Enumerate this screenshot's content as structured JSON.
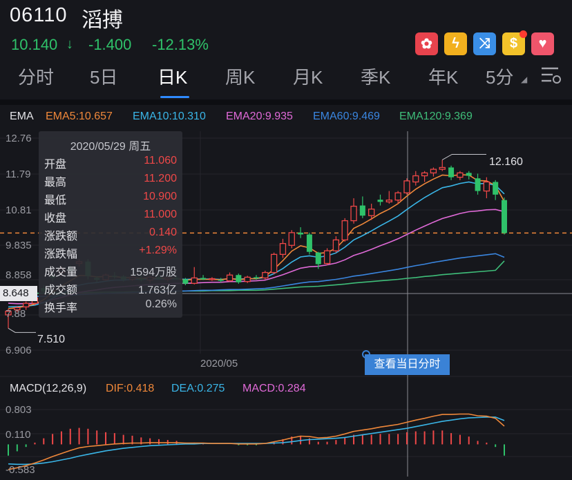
{
  "header": {
    "code": "06110",
    "name": "滔搏",
    "price": "10.140",
    "price_arrow": "↓",
    "change": "-1.400",
    "change_pct": "-12.13%"
  },
  "badges": [
    {
      "icon": "hk-flag-icon",
      "glyph": "✿",
      "color": "#e8434d"
    },
    {
      "icon": "lightning-icon",
      "glyph": "ϟ",
      "color": "#f2b01e"
    },
    {
      "icon": "shuffle-icon",
      "glyph": "⤨",
      "color": "#3a8ee6"
    },
    {
      "icon": "dollar-icon",
      "glyph": "$",
      "color": "#f2c22a"
    },
    {
      "icon": "heart-icon",
      "glyph": "♥",
      "color": "#f0556b"
    }
  ],
  "tabs": [
    "分时",
    "5日",
    "日K",
    "周K",
    "月K",
    "季K",
    "年K",
    "5分"
  ],
  "active_tab": "日K",
  "ema": {
    "label": "EMA",
    "items": [
      {
        "text": "EMA5:10.657",
        "color": "#f0883a"
      },
      {
        "text": "EMA10:10.310",
        "color": "#3ab6e8"
      },
      {
        "text": "EMA20:9.935",
        "color": "#e06ad8"
      },
      {
        "text": "EMA60:9.469",
        "color": "#3a86e0"
      },
      {
        "text": "EMA120:9.369",
        "color": "#3fbf7a"
      }
    ]
  },
  "price_axis": [
    "12.76",
    "11.79",
    "10.81",
    "9.835",
    "8.858",
    "7.88",
    "6.906"
  ],
  "crosshair_price": "8.648",
  "high_label": "12.160",
  "low_label": "7.510",
  "date_axis": "2020/05",
  "tooltip": {
    "date": "2020/05/29 周五",
    "rows": [
      {
        "k": "开盘",
        "v": "11.060",
        "c": "#f04848"
      },
      {
        "k": "最高",
        "v": "11.200",
        "c": "#f04848"
      },
      {
        "k": "最低",
        "v": "10.900",
        "c": "#f04848"
      },
      {
        "k": "收盘",
        "v": "11.000",
        "c": "#f04848"
      },
      {
        "k": "涨跌额",
        "v": "0.140",
        "c": "#f04848"
      },
      {
        "k": "涨跌幅",
        "v": "+1.29%",
        "c": "#f04848"
      },
      {
        "k": "成交量",
        "v": "1594万股",
        "c": "#c5c6cc"
      },
      {
        "k": "成交额",
        "v": "1.763亿",
        "c": "#c5c6cc"
      },
      {
        "k": "换手率",
        "v": "0.26%",
        "c": "#c5c6cc"
      }
    ]
  },
  "view_day_button": "查看当日分时",
  "macd": {
    "label": "MACD(12,26,9)",
    "dif": "DIF:0.418",
    "dea": "DEA:0.275",
    "macd": "MACD:0.284",
    "axis": [
      "0.803",
      "0.110",
      "-0.583"
    ]
  },
  "colors": {
    "up": "#f04848",
    "down": "#2fc26a",
    "bg": "#16171c",
    "accent": "#2f8bff"
  },
  "chart_data": {
    "type": "candlestick",
    "candles": [
      [
        7.88,
        8.05,
        7.51,
        7.98
      ],
      [
        8.02,
        8.12,
        7.95,
        8.08
      ],
      [
        8.1,
        8.25,
        8.02,
        8.2
      ],
      [
        8.2,
        8.4,
        8.15,
        8.35
      ],
      [
        8.62,
        8.7,
        8.48,
        8.52
      ],
      [
        8.95,
        9.05,
        8.8,
        8.9
      ],
      [
        9.05,
        9.22,
        8.95,
        9.15
      ],
      [
        9.18,
        9.25,
        9.05,
        9.1
      ],
      [
        9.3,
        9.42,
        9.22,
        9.35
      ],
      [
        9.35,
        9.42,
        8.86,
        8.95
      ],
      [
        8.9,
        8.95,
        8.78,
        8.85
      ],
      [
        8.85,
        9.02,
        8.82,
        8.98
      ],
      [
        8.96,
        9.06,
        8.88,
        8.94
      ],
      [
        8.94,
        8.98,
        8.8,
        8.86
      ],
      [
        8.86,
        8.96,
        8.82,
        8.92
      ],
      [
        8.88,
        9.0,
        8.8,
        8.84
      ],
      [
        8.84,
        8.96,
        8.76,
        8.92
      ],
      [
        8.92,
        8.98,
        8.86,
        8.88
      ],
      [
        8.86,
        8.92,
        8.8,
        8.9
      ],
      [
        8.9,
        8.96,
        8.85,
        8.87
      ],
      [
        8.86,
        8.9,
        8.7,
        8.74
      ],
      [
        8.75,
        9.2,
        8.72,
        8.9
      ],
      [
        8.9,
        8.98,
        8.84,
        8.86
      ],
      [
        8.86,
        8.92,
        8.82,
        8.88
      ],
      [
        8.85,
        8.9,
        8.78,
        8.82
      ],
      [
        8.82,
        9.05,
        8.8,
        8.98
      ],
      [
        8.98,
        9.02,
        8.74,
        8.78
      ],
      [
        8.8,
        8.96,
        8.76,
        8.92
      ],
      [
        8.92,
        8.98,
        8.85,
        8.9
      ],
      [
        8.9,
        9.1,
        8.86,
        9.05
      ],
      [
        9.05,
        9.6,
        9.0,
        9.55
      ],
      [
        9.55,
        9.98,
        9.45,
        9.85
      ],
      [
        9.8,
        10.22,
        9.72,
        10.15
      ],
      [
        10.15,
        10.3,
        10.0,
        10.1
      ],
      [
        10.1,
        10.15,
        9.55,
        9.62
      ],
      [
        9.6,
        9.62,
        9.15,
        9.28
      ],
      [
        9.3,
        9.72,
        9.25,
        9.65
      ],
      [
        9.65,
        10.05,
        9.6,
        9.95
      ],
      [
        9.95,
        10.55,
        9.9,
        10.48
      ],
      [
        10.48,
        11.1,
        10.4,
        10.88
      ],
      [
        10.9,
        11.15,
        10.55,
        10.62
      ],
      [
        10.62,
        10.95,
        10.5,
        10.8
      ],
      [
        11.06,
        11.2,
        10.9,
        11.0
      ],
      [
        11.0,
        11.3,
        10.95,
        11.05
      ],
      [
        11.05,
        11.3,
        10.95,
        11.25
      ],
      [
        11.25,
        11.65,
        11.2,
        11.58
      ],
      [
        11.55,
        11.85,
        11.45,
        11.72
      ],
      [
        11.72,
        11.85,
        11.55,
        11.8
      ],
      [
        11.8,
        11.95,
        11.7,
        11.9
      ],
      [
        11.9,
        12.16,
        11.85,
        11.95
      ],
      [
        11.95,
        12.0,
        11.6,
        11.68
      ],
      [
        11.68,
        11.85,
        11.6,
        11.8
      ],
      [
        11.8,
        11.85,
        11.62,
        11.72
      ],
      [
        11.65,
        11.78,
        11.2,
        11.3
      ],
      [
        11.3,
        11.68,
        11.1,
        11.55
      ],
      [
        11.55,
        11.6,
        11.05,
        11.2
      ],
      [
        11.05,
        11.12,
        10.1,
        10.14
      ]
    ],
    "ema5": [
      8.05,
      8.08,
      8.12,
      8.18,
      8.3,
      8.5,
      8.68,
      8.82,
      8.97,
      8.96,
      8.93,
      8.94,
      8.94,
      8.91,
      8.91,
      8.89,
      8.9,
      8.89,
      8.89,
      8.89,
      8.84,
      8.86,
      8.86,
      8.86,
      8.85,
      8.89,
      8.85,
      8.88,
      8.88,
      8.94,
      9.14,
      9.38,
      9.64,
      9.79,
      9.73,
      9.58,
      9.6,
      9.72,
      9.97,
      10.27,
      10.39,
      10.53,
      10.68,
      10.8,
      10.95,
      11.16,
      11.35,
      11.5,
      11.63,
      11.74,
      11.72,
      11.75,
      11.74,
      11.59,
      11.58,
      11.45,
      11.01
    ],
    "ema10": [
      8.1,
      8.11,
      8.12,
      8.15,
      8.22,
      8.34,
      8.46,
      8.58,
      8.7,
      8.75,
      8.77,
      8.81,
      8.84,
      8.84,
      8.86,
      8.86,
      8.87,
      8.87,
      8.87,
      8.88,
      8.86,
      8.87,
      8.87,
      8.87,
      8.86,
      8.88,
      8.87,
      8.88,
      8.88,
      8.91,
      9.02,
      9.16,
      9.34,
      9.48,
      9.51,
      9.47,
      9.51,
      9.59,
      9.75,
      9.95,
      10.07,
      10.2,
      10.34,
      10.47,
      10.61,
      10.79,
      10.96,
      11.12,
      11.26,
      11.39,
      11.44,
      11.51,
      11.55,
      11.5,
      11.51,
      11.46,
      11.22
    ],
    "ema20": [
      8.2,
      8.19,
      8.19,
      8.2,
      8.23,
      8.3,
      8.36,
      8.43,
      8.5,
      8.54,
      8.57,
      8.61,
      8.64,
      8.66,
      8.68,
      8.7,
      8.72,
      8.73,
      8.74,
      8.75,
      8.75,
      8.76,
      8.77,
      8.78,
      8.78,
      8.8,
      8.8,
      8.81,
      8.82,
      8.84,
      8.91,
      8.99,
      9.08,
      9.17,
      9.21,
      9.22,
      9.26,
      9.31,
      9.4,
      9.52,
      9.6,
      9.69,
      9.79,
      9.88,
      9.98,
      10.1,
      10.22,
      10.33,
      10.44,
      10.54,
      10.61,
      10.68,
      10.73,
      10.75,
      10.78,
      10.79,
      10.73
    ],
    "ema60": [
      8.4,
      8.39,
      8.39,
      8.39,
      8.39,
      8.4,
      8.41,
      8.42,
      8.44,
      8.45,
      8.46,
      8.47,
      8.48,
      8.49,
      8.5,
      8.51,
      8.52,
      8.52,
      8.53,
      8.54,
      8.54,
      8.55,
      8.56,
      8.56,
      8.57,
      8.58,
      8.58,
      8.59,
      8.6,
      8.61,
      8.64,
      8.68,
      8.72,
      8.76,
      8.79,
      8.8,
      8.83,
      8.86,
      8.9,
      8.95,
      8.98,
      9.02,
      9.06,
      9.1,
      9.14,
      9.19,
      9.24,
      9.28,
      9.33,
      9.37,
      9.41,
      9.45,
      9.48,
      9.51,
      9.54,
      9.57,
      9.47
    ],
    "ema120": [
      8.48,
      8.48,
      8.48,
      8.48,
      8.48,
      8.49,
      8.49,
      8.49,
      8.5,
      8.5,
      8.5,
      8.51,
      8.51,
      8.51,
      8.52,
      8.52,
      8.52,
      8.53,
      8.53,
      8.53,
      8.54,
      8.54,
      8.54,
      8.55,
      8.55,
      8.55,
      8.56,
      8.56,
      8.56,
      8.57,
      8.59,
      8.61,
      8.63,
      8.65,
      8.66,
      8.67,
      8.69,
      8.71,
      8.73,
      8.76,
      8.78,
      8.8,
      8.82,
      8.84,
      8.86,
      8.89,
      8.91,
      8.94,
      8.96,
      8.99,
      9.01,
      9.03,
      9.05,
      9.07,
      9.09,
      9.11,
      9.37
    ],
    "price_range": [
      6.906,
      12.76
    ],
    "macd_range": [
      -0.583,
      0.803
    ],
    "dif": [
      -0.58,
      -0.54,
      -0.49,
      -0.43,
      -0.36,
      -0.28,
      -0.21,
      -0.14,
      -0.08,
      -0.05,
      -0.03,
      -0.01,
      0.01,
      0.02,
      0.03,
      0.03,
      0.04,
      0.04,
      0.04,
      0.04,
      0.03,
      0.03,
      0.03,
      0.02,
      0.02,
      0.02,
      0.01,
      0.01,
      0.01,
      0.02,
      0.06,
      0.1,
      0.15,
      0.19,
      0.18,
      0.15,
      0.16,
      0.19,
      0.24,
      0.3,
      0.33,
      0.36,
      0.4,
      0.43,
      0.46,
      0.51,
      0.56,
      0.6,
      0.65,
      0.69,
      0.69,
      0.7,
      0.7,
      0.66,
      0.65,
      0.6,
      0.42
    ],
    "dea": [
      -0.45,
      -0.46,
      -0.46,
      -0.45,
      -0.43,
      -0.4,
      -0.36,
      -0.32,
      -0.27,
      -0.23,
      -0.19,
      -0.15,
      -0.12,
      -0.09,
      -0.07,
      -0.05,
      -0.03,
      -0.02,
      -0.01,
      0.0,
      0.01,
      0.01,
      0.02,
      0.02,
      0.02,
      0.02,
      0.02,
      0.02,
      0.02,
      0.02,
      0.03,
      0.04,
      0.06,
      0.09,
      0.11,
      0.12,
      0.13,
      0.14,
      0.16,
      0.19,
      0.22,
      0.25,
      0.28,
      0.31,
      0.34,
      0.37,
      0.41,
      0.45,
      0.49,
      0.53,
      0.56,
      0.59,
      0.61,
      0.62,
      0.63,
      0.63,
      0.55
    ]
  }
}
